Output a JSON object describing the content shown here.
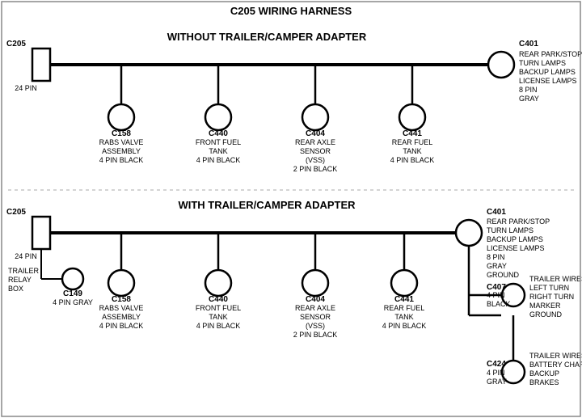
{
  "title": "C205 WIRING HARNESS",
  "section1": {
    "label": "WITHOUT TRAILER/CAMPER ADAPTER",
    "leftConnector": {
      "id": "C205",
      "pins": "24 PIN",
      "shape": "rect"
    },
    "rightConnector": {
      "id": "C401",
      "pins": "8 PIN",
      "color": "GRAY",
      "labels": [
        "REAR PARK/STOP",
        "TURN LAMPS",
        "BACKUP LAMPS",
        "LICENSE LAMPS"
      ]
    },
    "midConnectors": [
      {
        "id": "C158",
        "labels": [
          "RABS VALVE",
          "ASSEMBLY",
          "4 PIN BLACK"
        ]
      },
      {
        "id": "C440",
        "labels": [
          "FRONT FUEL",
          "TANK",
          "4 PIN BLACK"
        ]
      },
      {
        "id": "C404",
        "labels": [
          "REAR AXLE",
          "SENSOR",
          "(VSS)",
          "2 PIN BLACK"
        ]
      },
      {
        "id": "C441",
        "labels": [
          "REAR FUEL",
          "TANK",
          "4 PIN BLACK"
        ]
      }
    ]
  },
  "section2": {
    "label": "WITH TRAILER/CAMPER ADAPTER",
    "leftConnector": {
      "id": "C205",
      "pins": "24 PIN",
      "shape": "rect"
    },
    "rightConnector": {
      "id": "C401",
      "pins": "8 PIN",
      "color": "GRAY",
      "labels": [
        "REAR PARK/STOP",
        "TURN LAMPS",
        "BACKUP LAMPS",
        "LICENSE LAMPS",
        "GROUND"
      ]
    },
    "extraLeft": {
      "id": "C149",
      "pins": "4 PIN GRAY",
      "label": "TRAILER\nRELAY\nBOX"
    },
    "midConnectors": [
      {
        "id": "C158",
        "labels": [
          "RABS VALVE",
          "ASSEMBLY",
          "4 PIN BLACK"
        ]
      },
      {
        "id": "C440",
        "labels": [
          "FRONT FUEL",
          "TANK",
          "4 PIN BLACK"
        ]
      },
      {
        "id": "C404",
        "labels": [
          "REAR AXLE",
          "SENSOR",
          "(VSS)",
          "2 PIN BLACK"
        ]
      },
      {
        "id": "C441",
        "labels": [
          "REAR FUEL",
          "TANK",
          "4 PIN BLACK"
        ]
      }
    ],
    "rightExtra1": {
      "id": "C407",
      "pins": "4 PIN",
      "color": "BLACK",
      "labels": [
        "TRAILER WIRES",
        "LEFT TURN",
        "RIGHT TURN",
        "MARKER",
        "GROUND"
      ]
    },
    "rightExtra2": {
      "id": "C424",
      "pins": "4 PIN",
      "color": "GRAY",
      "labels": [
        "TRAILER WIRES",
        "BATTERY CHARGE",
        "BACKUP",
        "BRAKES"
      ]
    }
  }
}
